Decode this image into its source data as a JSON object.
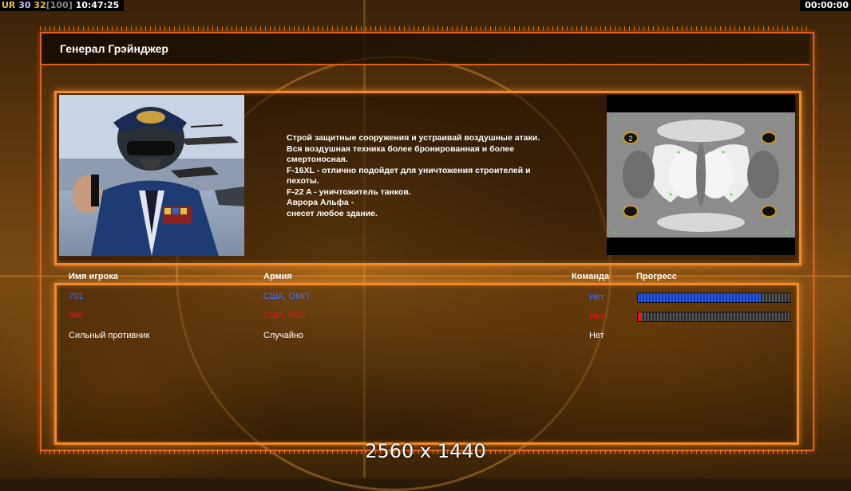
{
  "hud": {
    "ur_label": "UR",
    "value_a": "30",
    "value_b": "32",
    "value_c": "[100]",
    "clock": "10:47:25",
    "timer": "00:00:00"
  },
  "title": "Генерал Грэйнджер",
  "briefing": "Строй защитные сооружения и устраивай воздушные атаки.\nВся воздушная техника более бронированная и более\nсмертоносная.\nF-16XL - отлично подойдет для уничтожения строителей и\n пехоты.\nF-22 A - уничтожитель танков.\nАврора Альфа -\nснесет любое здание.",
  "minimap": {
    "start_marker_label": "2"
  },
  "table": {
    "headers": {
      "player": "Имя игрока",
      "army": "Армия",
      "team": "Команда",
      "progress": "Прогресс"
    },
    "rows": [
      {
        "player": "701",
        "army": "США, ОМП",
        "team": "Нет",
        "progress": 0.81,
        "color": "#4a6cff"
      },
      {
        "player": "880",
        "army": "США, ВВС",
        "team": "Нет",
        "progress": 0.02,
        "color": "#e01818"
      },
      {
        "player": "Сильный противник",
        "army": "Случайно",
        "team": "Нет",
        "progress": null,
        "color": "#ffffff"
      }
    ]
  },
  "resolution_label": "2560 x 1440",
  "colors": {
    "frame_orange": "#e2601c",
    "panel_glow": "#f08a2a"
  }
}
